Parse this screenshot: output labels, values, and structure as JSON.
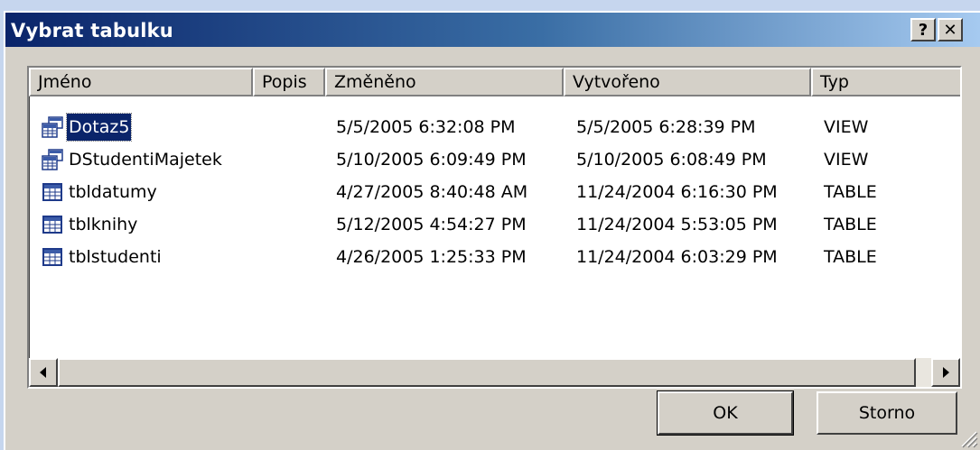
{
  "window": {
    "title": "Vybrat tabulku",
    "help_label": "?",
    "close_label": "✕"
  },
  "columns": [
    {
      "label": "Jméno"
    },
    {
      "label": "Popis"
    },
    {
      "label": "Změněno"
    },
    {
      "label": "Vytvořeno"
    },
    {
      "label": "Typ"
    }
  ],
  "rows": [
    {
      "icon": "query-view-icon",
      "name": "Dotaz5",
      "desc": "",
      "modified": "5/5/2005 6:32:08 PM",
      "created": "5/5/2005 6:28:39 PM",
      "type": "VIEW",
      "selected": true
    },
    {
      "icon": "query-view-icon",
      "name": "DStudentiMajetek",
      "desc": "",
      "modified": "5/10/2005 6:09:49 PM",
      "created": "5/10/2005 6:08:49 PM",
      "type": "VIEW",
      "selected": false
    },
    {
      "icon": "table-icon",
      "name": "tbldatumy",
      "desc": "",
      "modified": "4/27/2005 8:40:48 AM",
      "created": "11/24/2004 6:16:30 PM",
      "type": "TABLE",
      "selected": false
    },
    {
      "icon": "table-icon",
      "name": "tblknihy",
      "desc": "",
      "modified": "5/12/2005 4:54:27 PM",
      "created": "11/24/2004 5:53:05 PM",
      "type": "TABLE",
      "selected": false
    },
    {
      "icon": "table-icon",
      "name": "tblstudenti",
      "desc": "",
      "modified": "4/26/2005 1:25:33 PM",
      "created": "11/24/2004 6:03:29 PM",
      "type": "TABLE",
      "selected": false
    }
  ],
  "buttons": {
    "ok": "OK",
    "cancel": "Storno"
  },
  "colors": {
    "title_start": "#0a246a",
    "title_end": "#a6caf0",
    "selection": "#0a246a",
    "face": "#d4d0c8"
  }
}
